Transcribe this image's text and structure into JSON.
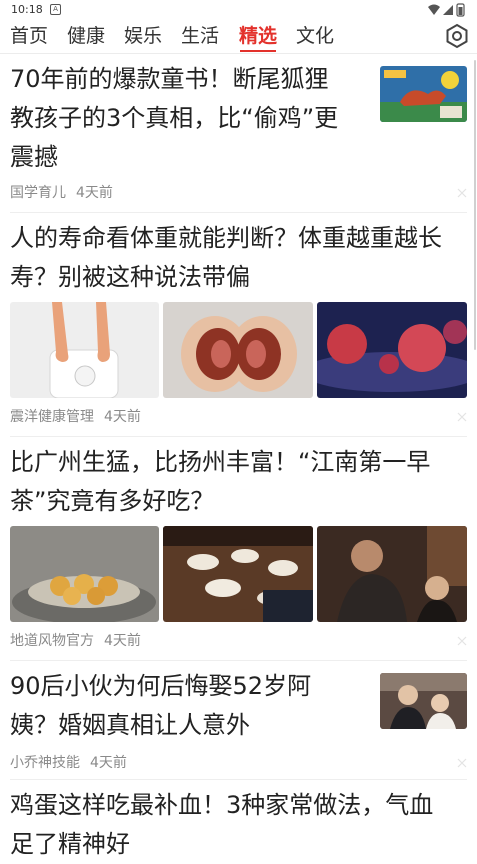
{
  "status": {
    "time": "10:18",
    "badge": "A"
  },
  "nav": {
    "tabs": [
      {
        "label": "首页"
      },
      {
        "label": "健康"
      },
      {
        "label": "娱乐"
      },
      {
        "label": "生活"
      },
      {
        "label": "精选"
      },
      {
        "label": "文化"
      }
    ],
    "active_tab": "精选",
    "accent": "#e3322c"
  },
  "feed": [
    {
      "title_lines": [
        "70年前的爆款童书！断尾狐狸",
        "教孩子的3个真相，比“偷鸡”更",
        "震撼"
      ],
      "source": "国学育儿",
      "time": "4天前"
    },
    {
      "title_lines": [
        "人的寿命看体重就能判断？体重越重越长",
        "寿？别被这种说法带偏"
      ],
      "source": "震洋健康管理",
      "time": "4天前"
    },
    {
      "title_lines": [
        "比广州生猛，比扬州丰富！“江南第一早",
        "茶”究竟有多好吃？"
      ],
      "source": "地道风物官方",
      "time": "4天前"
    },
    {
      "title_lines": [
        "90后小伙为何后悔娶52岁阿",
        "姨？婚姻真相让人意外"
      ],
      "source": "小乔神技能",
      "time": "4天前"
    },
    {
      "title_lines": [
        "鸡蛋这样吃最补血！3种家常做法，气血",
        "足了精神好"
      ]
    }
  ]
}
